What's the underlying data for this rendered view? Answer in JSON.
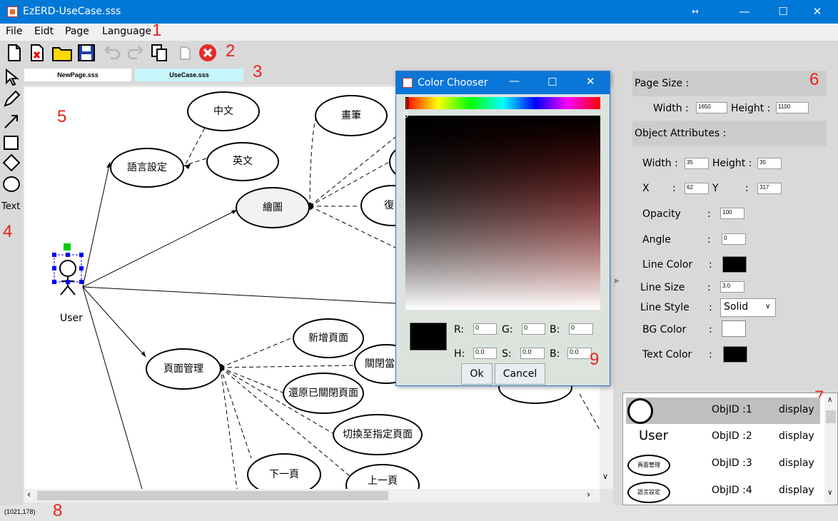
{
  "window": {
    "title": "EzERD-UseCase.sss",
    "restore_glyph": "↔",
    "min_glyph": "—",
    "max_glyph": "☐",
    "close_glyph": "✕"
  },
  "menu": {
    "items": [
      "File",
      "Eidt",
      "Page",
      "Language"
    ]
  },
  "annotations": [
    "1",
    "2",
    "3",
    "4",
    "5",
    "6",
    "7",
    "8",
    "9"
  ],
  "toolbar": {
    "icons": [
      "new-page-icon",
      "close-page-icon",
      "open-folder-icon",
      "save-icon",
      "undo-icon",
      "redo-icon",
      "copy-icon",
      "paste-icon",
      "exit-icon"
    ]
  },
  "tabs": [
    "NewPage.sss",
    "UseCase.sss"
  ],
  "tools": {
    "text_label": "Text",
    "icons": [
      "select-arrow-icon",
      "pencil-icon",
      "line-arrow-icon",
      "rectangle-icon",
      "diamond-icon",
      "ellipse-icon"
    ]
  },
  "canvas": {
    "actor_label": "User",
    "nodes": [
      "中文",
      "畫筆",
      "語言設定",
      "英文",
      "繪圖",
      "復",
      "新增頁面",
      "關閉當前",
      "頁面管理",
      "還原已關閉頁面",
      "切換至指定頁面",
      "下一頁",
      "上一頁"
    ]
  },
  "properties": {
    "page_size_title": "Page Size :",
    "page_width_label": "Width :",
    "page_width": "1650",
    "page_height_label": "Height :",
    "page_height": "1100",
    "object_title": "Object Attributes :",
    "width_label": "Width :",
    "width": "35",
    "height_label": "Height :",
    "height": "35",
    "x_label": "X",
    "x": "62",
    "y_label": "Y",
    "y": "317",
    "colon": ":",
    "opacity_label": "Opacity",
    "opacity": "100",
    "angle_label": "Angle",
    "angle": "0",
    "line_color_label": "Line Color",
    "line_color": "#000000",
    "line_size_label": "Line Size",
    "line_size": "3.0",
    "line_style_label": "Line Style",
    "line_style": "Solid",
    "bg_color_label": "BG Color",
    "bg_color": "#ffffff",
    "text_color_label": "Text Color",
    "text_color": "#000000"
  },
  "object_list": [
    {
      "thumb": "",
      "id": "ObjID :1",
      "action": "display"
    },
    {
      "thumb": "User",
      "id": "ObjID :2",
      "action": "display"
    },
    {
      "thumb": "頁面管理",
      "id": "ObjID :3",
      "action": "display"
    },
    {
      "thumb": "語言設定",
      "id": "ObjID :4",
      "action": "display"
    }
  ],
  "status": {
    "coords": "(1021,178)"
  },
  "color_chooser": {
    "title": "Color Chooser",
    "preview_color": "#000000",
    "r_label": "R:",
    "r": "0",
    "g_label": "G:",
    "g": "0",
    "b_label": "B:",
    "b": "0",
    "h_label": "H:",
    "h": "0.0",
    "s_label": "S:",
    "s": "0.0",
    "b2_label": "B:",
    "b2": "0.0",
    "ok": "Ok",
    "cancel": "Cancel"
  },
  "colors": {
    "titlebar": "#0078d7",
    "annotation": "#e8221a",
    "selection": "#0000ff",
    "handle": "#00cc00",
    "active_tab": "#c7f6fb"
  }
}
